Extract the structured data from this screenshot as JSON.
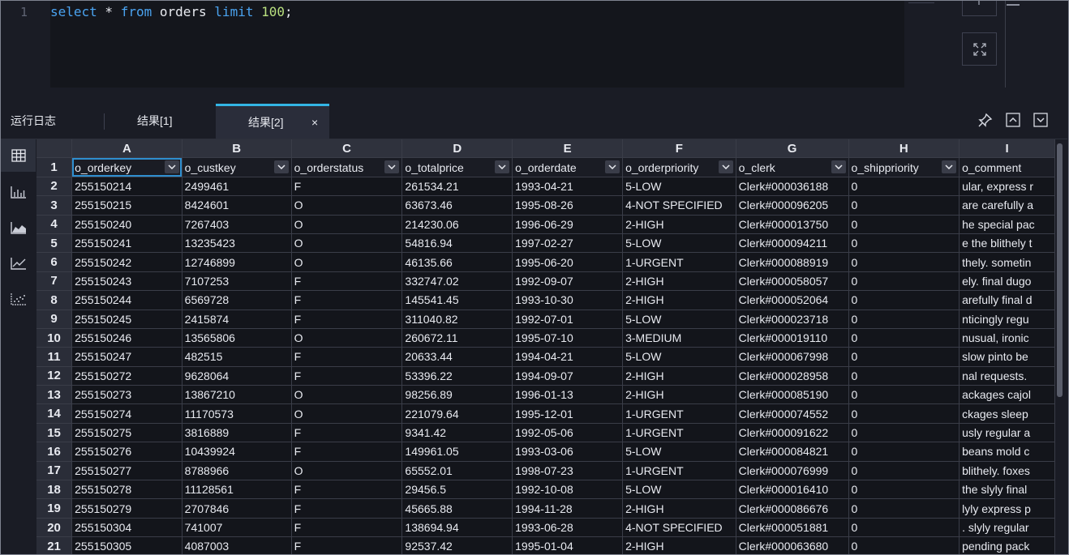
{
  "editor": {
    "line_number": "1",
    "code": {
      "select": "select",
      "star": " * ",
      "from": "from",
      "table": " orders ",
      "limit": "limit",
      "space": " ",
      "count": "100",
      "semi": ";"
    }
  },
  "tabs": {
    "log": "运行日志",
    "result1": "结果[1]",
    "result2": "结果[2]",
    "close": "×"
  },
  "sidebar": {
    "icons": [
      "table-icon",
      "bar-chart-icon",
      "area-chart-icon",
      "line-chart-icon",
      "scatter-chart-icon"
    ]
  },
  "grid": {
    "column_letters": [
      "A",
      "B",
      "C",
      "D",
      "E",
      "F",
      "G",
      "H",
      "I"
    ],
    "fields": [
      "o_orderkey",
      "o_custkey",
      "o_orderstatus",
      "o_totalprice",
      "o_orderdate",
      "o_orderpriority",
      "o_clerk",
      "o_shippriority",
      "o_comment"
    ],
    "header_row_number": "1",
    "rows": [
      {
        "n": "2",
        "c": [
          "255150214",
          "2499461",
          "F",
          "261534.21",
          "1993-04-21",
          "5-LOW",
          "Clerk#000036188",
          "0",
          "ular, express r"
        ]
      },
      {
        "n": "3",
        "c": [
          "255150215",
          "8424601",
          "O",
          "63673.46",
          "1995-08-26",
          "4-NOT SPECIFIED",
          "Clerk#000096205",
          "0",
          "are carefully a"
        ]
      },
      {
        "n": "4",
        "c": [
          "255150240",
          "7267403",
          "O",
          "214230.06",
          "1996-06-29",
          "2-HIGH",
          "Clerk#000013750",
          "0",
          "he special pac"
        ]
      },
      {
        "n": "5",
        "c": [
          "255150241",
          "13235423",
          "O",
          "54816.94",
          "1997-02-27",
          "5-LOW",
          "Clerk#000094211",
          "0",
          "e the blithely t"
        ]
      },
      {
        "n": "6",
        "c": [
          "255150242",
          "12746899",
          "O",
          "46135.66",
          "1995-06-20",
          "1-URGENT",
          "Clerk#000088919",
          "0",
          "thely. sometin"
        ]
      },
      {
        "n": "7",
        "c": [
          "255150243",
          "7107253",
          "F",
          "332747.02",
          "1992-09-07",
          "2-HIGH",
          "Clerk#000058057",
          "0",
          "ely. final dugo"
        ]
      },
      {
        "n": "8",
        "c": [
          "255150244",
          "6569728",
          "F",
          "145541.45",
          "1993-10-30",
          "2-HIGH",
          "Clerk#000052064",
          "0",
          "arefully final d"
        ]
      },
      {
        "n": "9",
        "c": [
          "255150245",
          "2415874",
          "F",
          "311040.82",
          "1992-07-01",
          "5-LOW",
          "Clerk#000023718",
          "0",
          "nticingly regu"
        ]
      },
      {
        "n": "10",
        "c": [
          "255150246",
          "13565806",
          "O",
          "260672.11",
          "1995-07-10",
          "3-MEDIUM",
          "Clerk#000019110",
          "0",
          "nusual, ironic"
        ]
      },
      {
        "n": "11",
        "c": [
          "255150247",
          "482515",
          "F",
          "20633.44",
          "1994-04-21",
          "5-LOW",
          "Clerk#000067998",
          "0",
          " slow pinto be"
        ]
      },
      {
        "n": "12",
        "c": [
          "255150272",
          "9628064",
          "F",
          "53396.22",
          "1994-09-07",
          "2-HIGH",
          "Clerk#000028958",
          "0",
          "nal requests. "
        ]
      },
      {
        "n": "13",
        "c": [
          "255150273",
          "13867210",
          "O",
          "98256.89",
          "1996-01-13",
          "2-HIGH",
          "Clerk#000085190",
          "0",
          "ackages cajol"
        ]
      },
      {
        "n": "14",
        "c": [
          "255150274",
          "11170573",
          "O",
          "221079.64",
          "1995-12-01",
          "1-URGENT",
          "Clerk#000074552",
          "0",
          "ckages sleep"
        ]
      },
      {
        "n": "15",
        "c": [
          "255150275",
          "3816889",
          "F",
          "9341.42",
          "1992-05-06",
          "1-URGENT",
          "Clerk#000091622",
          "0",
          "usly regular a"
        ]
      },
      {
        "n": "16",
        "c": [
          "255150276",
          "10439924",
          "F",
          "149961.05",
          "1993-03-06",
          "5-LOW",
          "Clerk#000084821",
          "0",
          "beans mold c"
        ]
      },
      {
        "n": "17",
        "c": [
          "255150277",
          "8788966",
          "O",
          "65552.01",
          "1998-07-23",
          "1-URGENT",
          "Clerk#000076999",
          "0",
          " blithely. foxes"
        ]
      },
      {
        "n": "18",
        "c": [
          "255150278",
          "11128561",
          "F",
          "29456.5",
          "1992-10-08",
          "5-LOW",
          "Clerk#000016410",
          "0",
          " the slyly final"
        ]
      },
      {
        "n": "19",
        "c": [
          "255150279",
          "2707846",
          "F",
          "45665.88",
          "1994-11-28",
          "2-HIGH",
          "Clerk#000086676",
          "0",
          "lyly express p"
        ]
      },
      {
        "n": "20",
        "c": [
          "255150304",
          "741007",
          "F",
          "138694.94",
          "1993-06-28",
          "4-NOT SPECIFIED",
          "Clerk#000051881",
          "0",
          ". slyly regular"
        ]
      },
      {
        "n": "21",
        "c": [
          "255150305",
          "4087003",
          "F",
          "92537.42",
          "1995-01-04",
          "2-HIGH",
          "Clerk#000063680",
          "0",
          " pending pack"
        ]
      }
    ]
  },
  "colors": {
    "accent": "#33b5e5",
    "keyword": "#4aa3f0",
    "number": "#b9e07f",
    "background": "#1a1c25"
  }
}
